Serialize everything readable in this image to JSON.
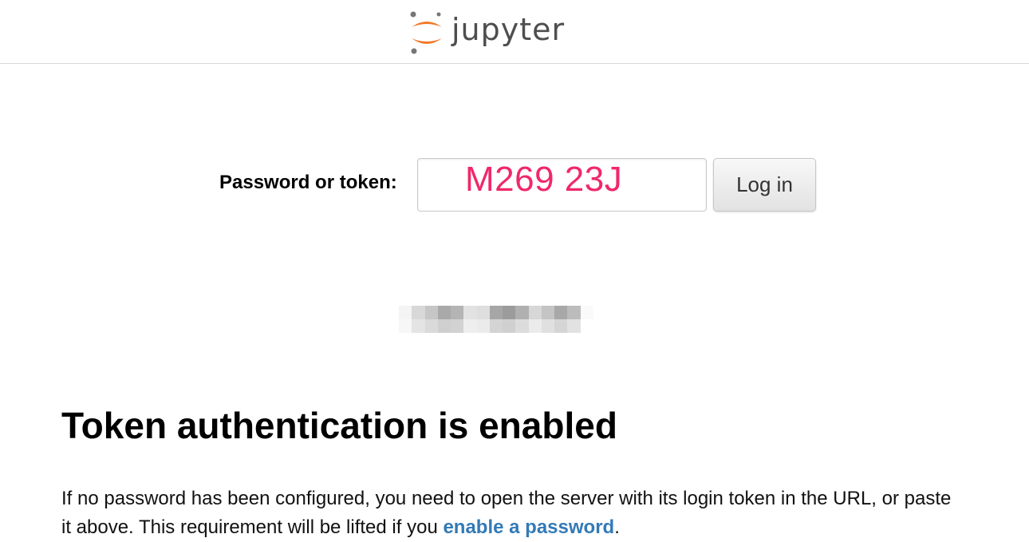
{
  "header": {
    "logo_text": "jupyter"
  },
  "login": {
    "label": "Password or token:",
    "input_value": "",
    "input_annotation": "M269 23J",
    "button_label": "Log in"
  },
  "info": {
    "title": "Token authentication is enabled",
    "text_before_link": "If no password has been configured, you need to open the server with its login token in the URL, or paste it above. This requirement will be lifted if you ",
    "link_text": "enable a password",
    "text_after_link": "."
  },
  "colors": {
    "logo_orange": "#f37726",
    "logo_gray": "#767677",
    "annotation_pink": "#f0286a",
    "link_blue": "#337ab7"
  }
}
